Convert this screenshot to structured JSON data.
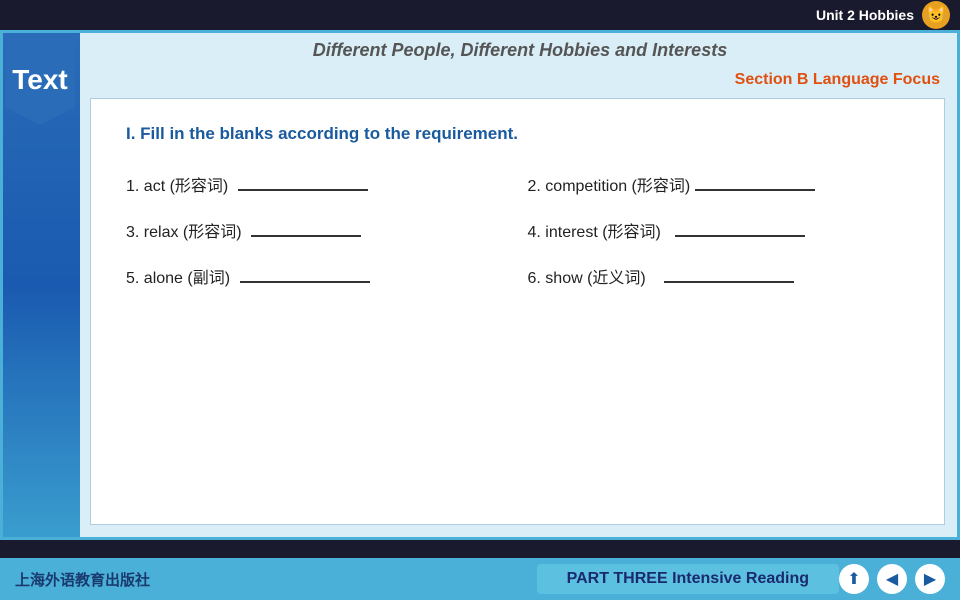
{
  "topbar": {
    "unit_title": "Unit 2 Hobbies",
    "icon": "😺"
  },
  "sidebar": {
    "label": "Text"
  },
  "header": {
    "title": "Different People, Different Hobbies and Interests"
  },
  "section": {
    "label": "Section B Language Focus"
  },
  "exercise": {
    "instruction": "I. Fill in the blanks according to the requirement.",
    "items": [
      {
        "number": "1.",
        "word": "act",
        "type": "形容词",
        "blank_width": 130
      },
      {
        "number": "2.",
        "word": "competition",
        "type": "形容词",
        "blank_width": 120
      },
      {
        "number": "3.",
        "word": "relax",
        "type": "形容词",
        "blank_width": 120
      },
      {
        "number": "4.",
        "word": "interest",
        "type": "形容词",
        "blank_width": 130
      },
      {
        "number": "5.",
        "word": "alone",
        "type": "副词",
        "blank_width": 130
      },
      {
        "number": "6.",
        "word": "show",
        "type": "近义词",
        "blank_width": 130
      }
    ]
  },
  "bottombar": {
    "publisher": "上海外语教育出版社",
    "part_label": "PART THREE Intensive Reading",
    "controls": [
      "⬆",
      "⏮",
      "⏭"
    ]
  }
}
